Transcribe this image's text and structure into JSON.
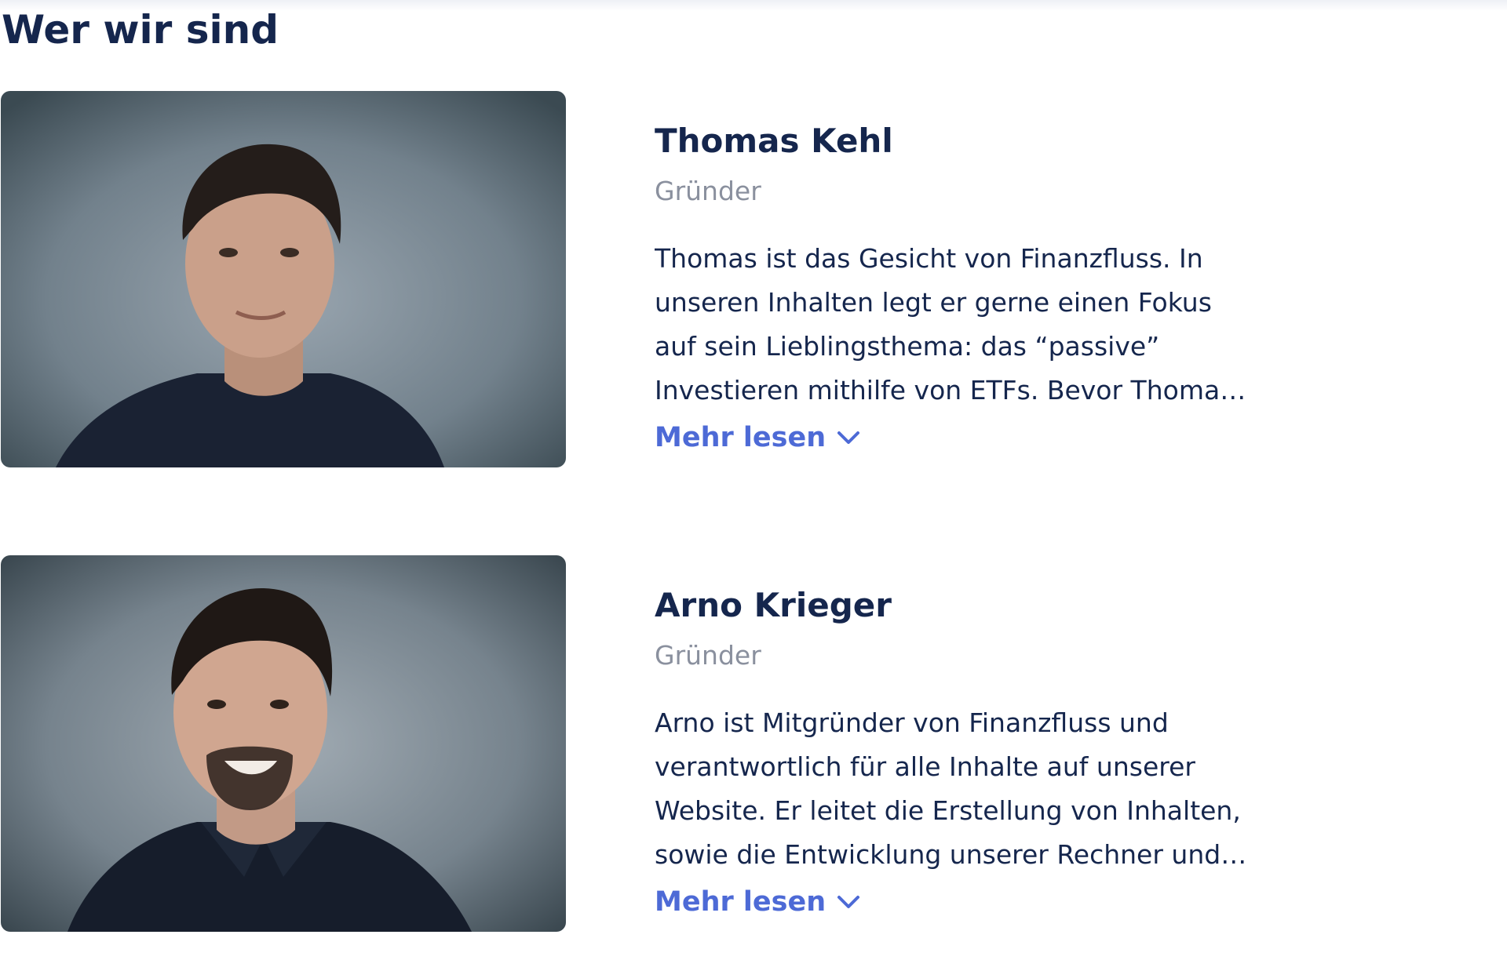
{
  "section": {
    "title": "Wer wir sind"
  },
  "team": [
    {
      "name": "Thomas Kehl",
      "role": "Gründer",
      "bio": "Thomas ist das Gesicht von Finanzfluss. In unseren Inhalten legt er gerne einen Fokus auf sein Lieblingsthema: das “passive” Investieren mithilfe von ETFs. Bevor Thomas …",
      "more_label": "Mehr lesen",
      "more_icon": "chevron-down-icon",
      "photo": "portrait-photo"
    },
    {
      "name": "Arno Krieger",
      "role": "Gründer",
      "bio": "Arno ist Mitgründer von Finanzfluss und verantwortlich für alle Inhalte auf unserer Website. Er leitet die Erstellung von Inhalten, sowie die Entwicklung unserer Rechner und …",
      "more_label": "Mehr lesen",
      "more_icon": "chevron-down-icon",
      "photo": "portrait-photo"
    }
  ],
  "colors": {
    "heading": "#15264d",
    "muted": "#8a909e",
    "link": "#4d6ad6",
    "photo_background": "#7d8b96"
  }
}
